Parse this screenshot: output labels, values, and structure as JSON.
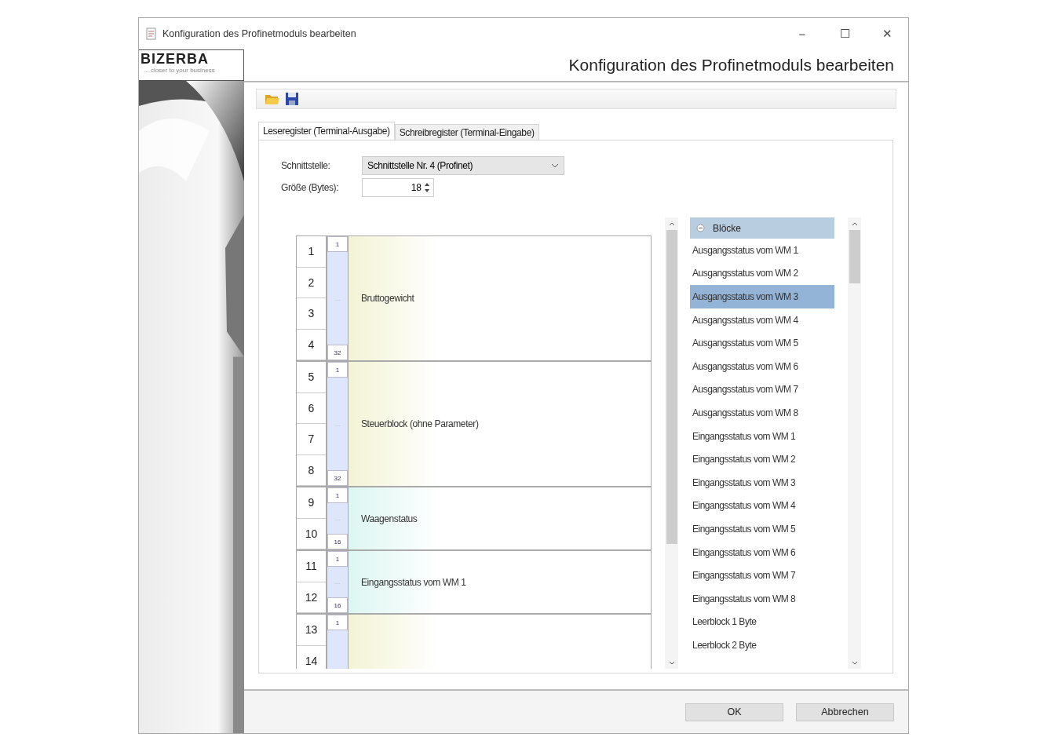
{
  "window": {
    "title": "Konfiguration des Profinetmoduls bearbeiten",
    "controls": [
      "−",
      "☐",
      "✕"
    ]
  },
  "logo": {
    "name": "BIZERBA",
    "tagline": "... closer to your business"
  },
  "header": {
    "title": "Konfiguration des Profinetmoduls bearbeiten"
  },
  "tabs": [
    {
      "label": "Leseregister (Terminal-Ausgabe)",
      "selected": true
    },
    {
      "label": "Schreibregister (Terminal-Eingabe)",
      "selected": false
    }
  ],
  "fields": {
    "interface_label": "Schnittstelle:",
    "interface_value": "Schnittstelle Nr. 4 (Profinet)",
    "size_label": "Größe (Bytes):",
    "size_value": "18"
  },
  "blocks": [
    {
      "label": "Bruttogewicht",
      "color": "#f3f3d6",
      "rows": [
        "1",
        "2",
        "3",
        "4"
      ],
      "bits": [
        "1",
        "...",
        "32"
      ]
    },
    {
      "label": "Steuerblock (ohne Parameter)",
      "color": "#f3f3d6",
      "rows": [
        "5",
        "6",
        "7",
        "8"
      ],
      "bits": [
        "1",
        "...",
        "32"
      ]
    },
    {
      "label": "Waagenstatus",
      "color": "#ddf6f2",
      "rows": [
        "9",
        "10"
      ],
      "bits": [
        "1",
        "...",
        "16"
      ]
    },
    {
      "label": "Eingangsstatus vom WM 1",
      "color": "#ddf6f2",
      "rows": [
        "11",
        "12"
      ],
      "bits": [
        "1",
        "...",
        "16"
      ]
    },
    {
      "color": "#f3f3d6",
      "rows": [
        "13",
        "14"
      ],
      "bits": [
        "1"
      ]
    }
  ],
  "palette": {
    "header": "Blöcke",
    "expanded": true,
    "items": [
      {
        "label": "Ausgangsstatus vom WM 1",
        "selected": false
      },
      {
        "label": "Ausgangsstatus vom WM 2",
        "selected": false
      },
      {
        "label": "Ausgangsstatus vom WM 3",
        "selected": true
      },
      {
        "label": "Ausgangsstatus vom WM 4",
        "selected": false
      },
      {
        "label": "Ausgangsstatus vom WM 5",
        "selected": false
      },
      {
        "label": "Ausgangsstatus vom WM 6",
        "selected": false
      },
      {
        "label": "Ausgangsstatus vom WM 7",
        "selected": false
      },
      {
        "label": "Ausgangsstatus vom WM 8",
        "selected": false
      },
      {
        "label": "Eingangsstatus vom WM 1",
        "selected": false
      },
      {
        "label": "Eingangsstatus vom WM 2",
        "selected": false
      },
      {
        "label": "Eingangsstatus vom WM 3",
        "selected": false
      },
      {
        "label": "Eingangsstatus vom WM 4",
        "selected": false
      },
      {
        "label": "Eingangsstatus vom WM 5",
        "selected": false
      },
      {
        "label": "Eingangsstatus vom WM 6",
        "selected": false
      },
      {
        "label": "Eingangsstatus vom WM 7",
        "selected": false
      },
      {
        "label": "Eingangsstatus vom WM 8",
        "selected": false
      },
      {
        "label": "Leerblock 1 Byte",
        "selected": false
      },
      {
        "label": "Leerblock 2 Byte",
        "selected": false
      }
    ]
  },
  "buttons": [
    "OK",
    "Abbrechen"
  ]
}
